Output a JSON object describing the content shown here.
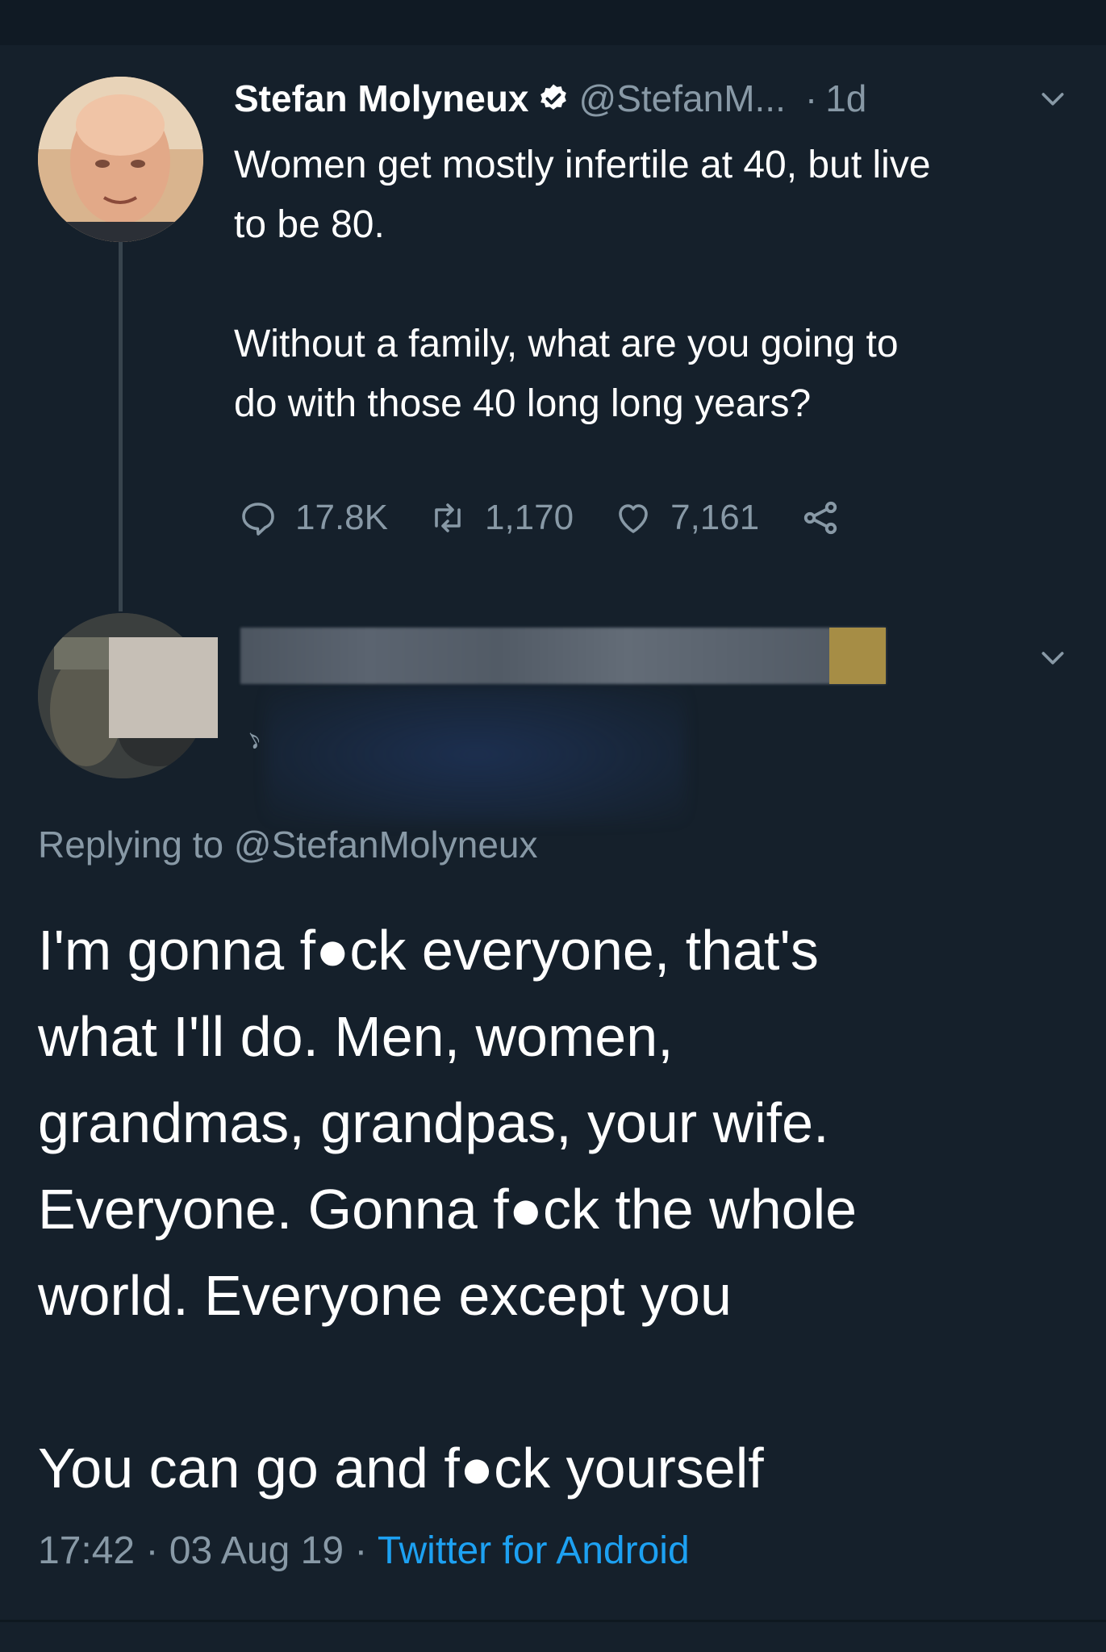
{
  "parent_tweet": {
    "author_name": "Stefan Molyneux",
    "author_handle": "@StefanM...",
    "separator": "·",
    "time": "1d",
    "text": "Women get mostly infertile at 40, but live\nto be 80.\n\nWithout a family, what are you going to\ndo with those 40 long long years?",
    "replies": "17.8K",
    "retweets": "1,170",
    "likes": "7,161",
    "icons": {
      "verified": "verified-badge-icon",
      "menu": "chevron-down-icon",
      "reply": "reply-icon",
      "retweet": "retweet-icon",
      "like": "heart-icon",
      "share": "share-icon"
    }
  },
  "reply_tweet": {
    "replying_to_label": "Replying to",
    "replying_to_handle": "@StefanMolyneux",
    "text": "I'm gonna f●ck everyone, that's\nwhat I'll do. Men, women,\ngrandmas, grandpas, your wife.\nEveryone. Gonna f●ck the whole\nworld. Everyone except you\n\nYou can go and f●ck yourself",
    "time": "17:42",
    "date": "03 Aug 19",
    "separator": "·",
    "source": "Twitter for Android"
  },
  "colors": {
    "background": "#15202b",
    "text_primary": "#ffffff",
    "text_secondary": "#8899a6",
    "accent": "#1da1f2"
  }
}
